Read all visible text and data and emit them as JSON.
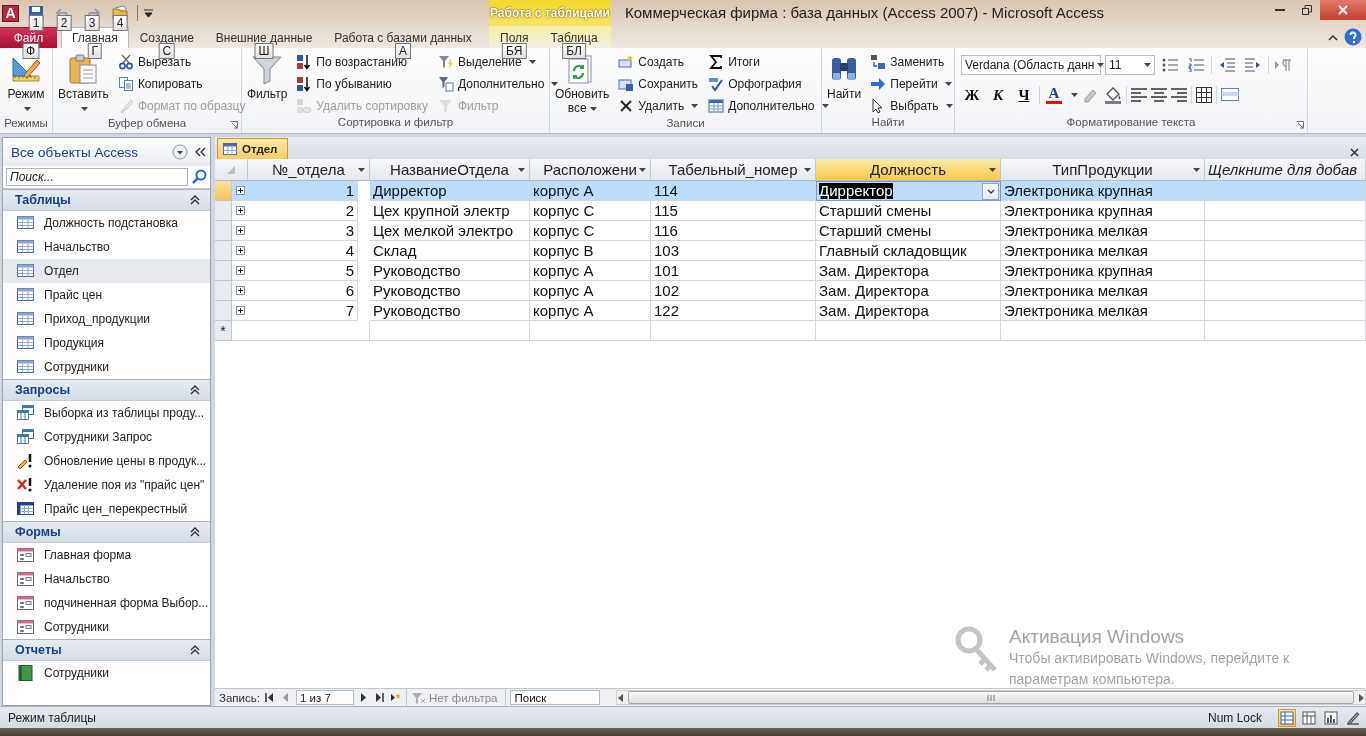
{
  "window": {
    "app_icon": "A",
    "title": "Коммерческая фирма : база данных (Access 2007)  -  Microsoft Access"
  },
  "quick_access": [
    {
      "keytip": "1",
      "disabled": false
    },
    {
      "keytip": "2",
      "disabled": true
    },
    {
      "keytip": "3",
      "disabled": true
    },
    {
      "keytip": "4",
      "disabled": false
    }
  ],
  "tabs": [
    {
      "label": "Файл",
      "kind": "file",
      "selected": false,
      "keytip": "Ф"
    },
    {
      "label": "Главная",
      "kind": "tab",
      "selected": true,
      "keytip": "Г"
    },
    {
      "label": "Создание",
      "kind": "tab",
      "selected": false,
      "keytip": "С"
    },
    {
      "label": "Внешние данные",
      "kind": "tab",
      "selected": false,
      "keytip": "Ш"
    },
    {
      "label": "Работа с базами данных",
      "kind": "tab",
      "selected": false,
      "keytip": "А"
    }
  ],
  "contextual_tabs": {
    "title": "Работа с таблицами",
    "tabs": [
      {
        "label": "Поля",
        "selected": false,
        "keytip": "БЯ"
      },
      {
        "label": "Таблица",
        "selected": false,
        "keytip": "БЛ"
      }
    ]
  },
  "ribbon_groups": [
    {
      "title": "Режимы",
      "large": [
        {
          "label": "Режим",
          "dropdown": true
        }
      ]
    },
    {
      "title": "Буфер обмена",
      "launcher": true,
      "large": [
        {
          "label": "Вставить",
          "dropdown": true
        }
      ],
      "small": [
        [
          {
            "label": "Вырезать",
            "disabled": false,
            "dropdown": false
          },
          {
            "label": "Копировать",
            "disabled": false,
            "dropdown": false
          },
          {
            "label": "Формат по образцу",
            "disabled": true,
            "dropdown": false
          }
        ]
      ]
    },
    {
      "title": "Сортировка и фильтр",
      "large": [
        {
          "label": "Фильтр",
          "dropdown": false
        }
      ],
      "small": [
        [
          {
            "label": "По возрастанию",
            "disabled": false,
            "dropdown": false
          },
          {
            "label": "По убыванию",
            "disabled": false,
            "dropdown": false
          },
          {
            "label": "Удалить сортировку",
            "disabled": true,
            "dropdown": false
          }
        ],
        [
          {
            "label": "Выделение",
            "disabled": false,
            "dropdown": true
          },
          {
            "label": "Дополнительно",
            "disabled": false,
            "dropdown": true
          },
          {
            "label": "Фильтр",
            "disabled": true,
            "dropdown": false
          }
        ]
      ]
    },
    {
      "title": "Записи",
      "large": [
        {
          "label": "Обновить все",
          "dropdown": true
        }
      ],
      "small": [
        [
          {
            "label": "Создать",
            "disabled": false,
            "dropdown": false
          },
          {
            "label": "Сохранить",
            "disabled": false,
            "dropdown": false
          },
          {
            "label": "Удалить",
            "disabled": false,
            "dropdown": true
          }
        ],
        [
          {
            "label": "Итоги",
            "disabled": false,
            "dropdown": false
          },
          {
            "label": "Орфография",
            "disabled": false,
            "dropdown": false
          },
          {
            "label": "Дополнительно",
            "disabled": false,
            "dropdown": true
          }
        ]
      ]
    },
    {
      "title": "Найти",
      "large": [
        {
          "label": "Найти",
          "dropdown": false
        }
      ],
      "small": [
        [
          {
            "label": "Заменить",
            "disabled": false,
            "dropdown": false
          },
          {
            "label": "Перейти",
            "disabled": false,
            "dropdown": true
          },
          {
            "label": "Выбрать",
            "disabled": false,
            "dropdown": true
          }
        ]
      ]
    }
  ],
  "text_format": {
    "title": "Форматирование текста",
    "launcher": true,
    "font": "Verdana (Область данн",
    "size": "11",
    "font_color_glyph": "A",
    "style_buttons": [
      {
        "label": "Ж",
        "kind": "bold"
      },
      {
        "label": "К",
        "kind": "italic"
      },
      {
        "label": "Ч",
        "kind": "underline"
      }
    ]
  },
  "navigation": {
    "title": "Все объекты Access",
    "search": {
      "placeholder": "Поиск..."
    },
    "sections": [
      {
        "title": "Таблицы",
        "expanded": true,
        "items": [
          {
            "label": "Должность подстановка",
            "kind": "table",
            "selected": false
          },
          {
            "label": "Начальство",
            "kind": "table",
            "selected": false
          },
          {
            "label": "Отдел",
            "kind": "table",
            "selected": true
          },
          {
            "label": "Прайс цен",
            "kind": "table",
            "selected": false
          },
          {
            "label": "Приход_продукции",
            "kind": "table",
            "selected": false
          },
          {
            "label": "Продукция",
            "kind": "table",
            "selected": false
          },
          {
            "label": "Сотрудники",
            "kind": "table",
            "selected": false
          }
        ]
      },
      {
        "title": "Запросы",
        "expanded": true,
        "items": [
          {
            "label": "Выборка из таблицы проду...",
            "kind": "select",
            "selected": false
          },
          {
            "label": "Сотрудники Запрос",
            "kind": "select",
            "selected": false
          },
          {
            "label": "Обновление цены в продук...",
            "kind": "update",
            "selected": false
          },
          {
            "label": "Удаление поя из \"прайс цен\"",
            "kind": "delete",
            "selected": false
          },
          {
            "label": "Прайс цен_перекрестный",
            "kind": "crosstab",
            "selected": false
          }
        ]
      },
      {
        "title": "Формы",
        "expanded": true,
        "items": [
          {
            "label": "Главная форма",
            "kind": "form",
            "selected": false
          },
          {
            "label": "Начальство",
            "kind": "form",
            "selected": false
          },
          {
            "label": "подчиненная форма Выбор...",
            "kind": "form",
            "selected": false
          },
          {
            "label": "Сотрудники",
            "kind": "form",
            "selected": false
          }
        ]
      },
      {
        "title": "Отчеты",
        "expanded": true,
        "items": [
          {
            "label": "Сотрудники",
            "kind": "report",
            "selected": false
          }
        ]
      }
    ]
  },
  "document": {
    "tab": "Отдел",
    "new_row_marker": "*",
    "columns": [
      {
        "label": "№_отдела",
        "kind": "field",
        "selected": false
      },
      {
        "label": "НазваниеОтдела",
        "kind": "field",
        "selected": false
      },
      {
        "label": "Расположени",
        "kind": "field",
        "selected": false
      },
      {
        "label": "Табельный_номер",
        "kind": "field",
        "selected": false
      },
      {
        "label": "Должность",
        "kind": "field",
        "selected": true
      },
      {
        "label": "ТипПродукции",
        "kind": "field",
        "selected": false
      },
      {
        "label": "Щелкните для добав",
        "kind": "add",
        "selected": false
      }
    ],
    "rows": [
      {
        "selected": true,
        "editing": true,
        "cells": [
          "1",
          "Дирректор",
          "корпус А",
          "114",
          "Дирректор",
          "Электроника крупная"
        ]
      },
      {
        "selected": false,
        "editing": false,
        "cells": [
          "2",
          "Цех крупной электр",
          "корпус С",
          "115",
          "Старший смены",
          "Электроника крупная"
        ]
      },
      {
        "selected": false,
        "editing": false,
        "cells": [
          "3",
          "Цех мелкой электро",
          "корпус С",
          "116",
          "Старший смены",
          "Электроника мелкая"
        ]
      },
      {
        "selected": false,
        "editing": false,
        "cells": [
          "4",
          "Склад",
          "корпус В",
          "103",
          "Главный складовщик",
          "Электроника мелкая"
        ]
      },
      {
        "selected": false,
        "editing": false,
        "cells": [
          "5",
          "Руководство",
          "корпус А",
          "101",
          "Зам. Директора",
          "Электроника крупная"
        ]
      },
      {
        "selected": false,
        "editing": false,
        "cells": [
          "6",
          "Руководство",
          "корпус А",
          "102",
          "Зам. Директора",
          "Электроника мелкая"
        ]
      },
      {
        "selected": false,
        "editing": false,
        "cells": [
          "7",
          "Руководство",
          "корпус А",
          "122",
          "Зам. Директора",
          "Электроника мелкая"
        ]
      }
    ]
  },
  "record_navigator": {
    "label": "Запись:",
    "position": "1 из 7",
    "filter": "Нет фильтра",
    "search": {
      "placeholder": "Поиск"
    }
  },
  "activation_notice": {
    "title": "Активация Windows",
    "lines": [
      "Чтобы активировать Windows, перейдите к",
      "параметрам компьютера."
    ]
  },
  "status_bar": {
    "mode": "Режим таблицы",
    "num_lock": "Num Lock",
    "views": [
      {
        "selected": true
      },
      {
        "selected": false
      },
      {
        "selected": false
      },
      {
        "selected": false
      }
    ]
  }
}
